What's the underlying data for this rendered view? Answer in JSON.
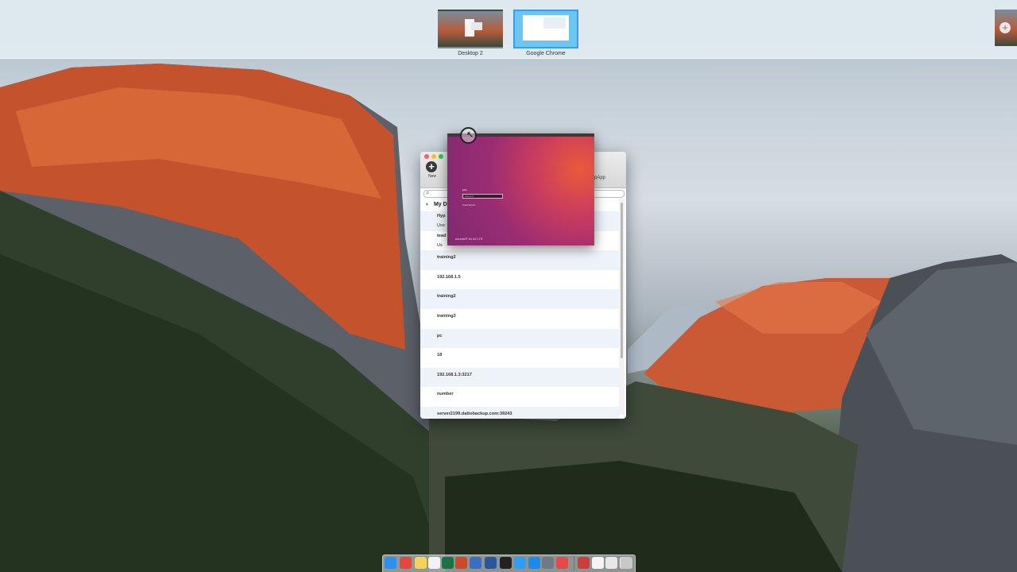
{
  "spaces": {
    "items": [
      {
        "label": "Desktop 2",
        "active": false
      },
      {
        "label": "Google Chrome",
        "active": true
      }
    ],
    "add_icon": "+"
  },
  "app_window": {
    "new_button_icon": "+",
    "new_button_label": "New",
    "toolbar_fragment": "pApp",
    "search_icon": "magnifier-icon",
    "group_label": "My D",
    "rows": [
      {
        "name": "Hyp",
        "sub": "Use"
      },
      {
        "name": "tead",
        "sub": "Us"
      },
      {
        "name": "training2",
        "sub": ""
      },
      {
        "name": "192.168.1.5",
        "sub": ""
      },
      {
        "name": "training2",
        "sub": ""
      },
      {
        "name": "training3",
        "sub": ""
      },
      {
        "name": "pc",
        "sub": ""
      },
      {
        "name": "18",
        "sub": ""
      },
      {
        "name": "192.168.1.3:3217",
        "sub": ""
      },
      {
        "name": "number",
        "sub": ""
      },
      {
        "name": "server2199.dattobackup.com:39243",
        "sub": ""
      }
    ]
  },
  "ubuntu_window": {
    "user_label": "jeffe",
    "password_placeholder": "Password",
    "guest_label": "Guest Session",
    "logo_text": "ubuntu® 16.04 LTS"
  },
  "dock": {
    "icons": [
      "finder-icon",
      "chrome-icon",
      "notes-icon",
      "itunes-icon",
      "excel-icon",
      "powerpoint-icon",
      "keynote-icon",
      "word-icon",
      "terminal-icon",
      "skype-icon",
      "safari-icon",
      "activity-icon",
      "messages-icon",
      "remote-desktop-icon",
      "calendar-icon",
      "preview-icon",
      "mail-icon",
      "trash-icon"
    ]
  },
  "colors": {
    "accent": "#3b99fc",
    "ubuntu_orange": "#ea5a3a",
    "ubuntu_aubergine": "#7e2a72"
  }
}
